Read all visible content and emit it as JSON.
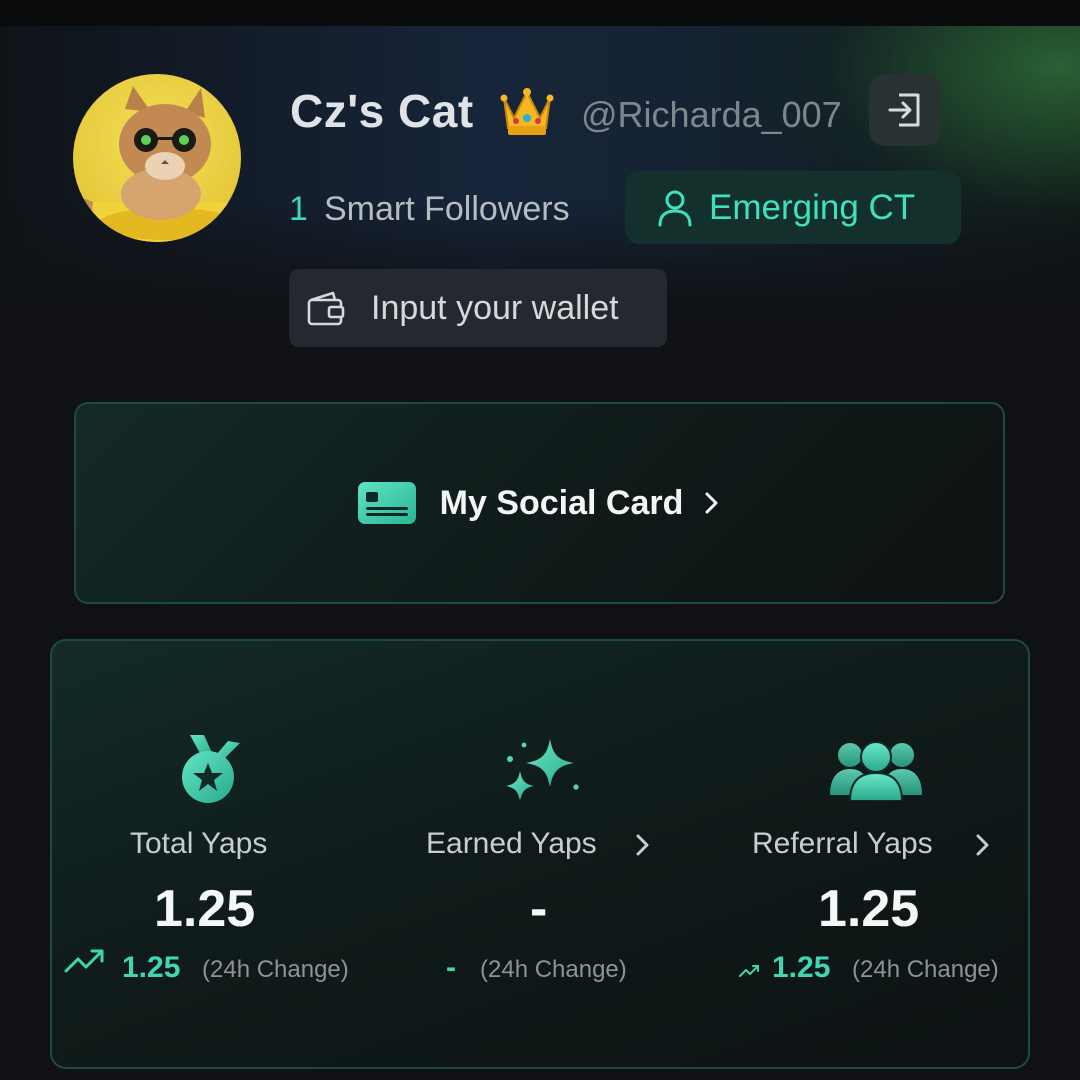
{
  "profile": {
    "name": "Cz's Cat",
    "handle": "@Richarda_007",
    "smart_followers_count": "1",
    "smart_followers_label": "Smart Followers",
    "tier_label": "Emerging CT",
    "wallet_button_label": "Input your wallet"
  },
  "social_card": {
    "label": "My Social Card"
  },
  "stats": {
    "total": {
      "title": "Total Yaps",
      "value": "1.25",
      "change": "1.25",
      "change_label": "(24h Change)"
    },
    "earned": {
      "title": "Earned Yaps",
      "value": "-",
      "change": "-",
      "change_label": "(24h Change)"
    },
    "referral": {
      "title": "Referral Yaps",
      "value": "1.25",
      "change": "1.25",
      "change_label": "(24h Change)"
    }
  },
  "colors": {
    "accent": "#3fd6b1",
    "background": "#0f1114",
    "badge_bg": "#13302d",
    "card_border": "#1f4a40"
  },
  "icons": [
    "crown-icon",
    "logout-icon",
    "user-icon",
    "wallet-icon",
    "id-card-icon",
    "medal-icon",
    "sparkles-icon",
    "users-icon",
    "trend-up-icon",
    "chevron-right-icon"
  ]
}
